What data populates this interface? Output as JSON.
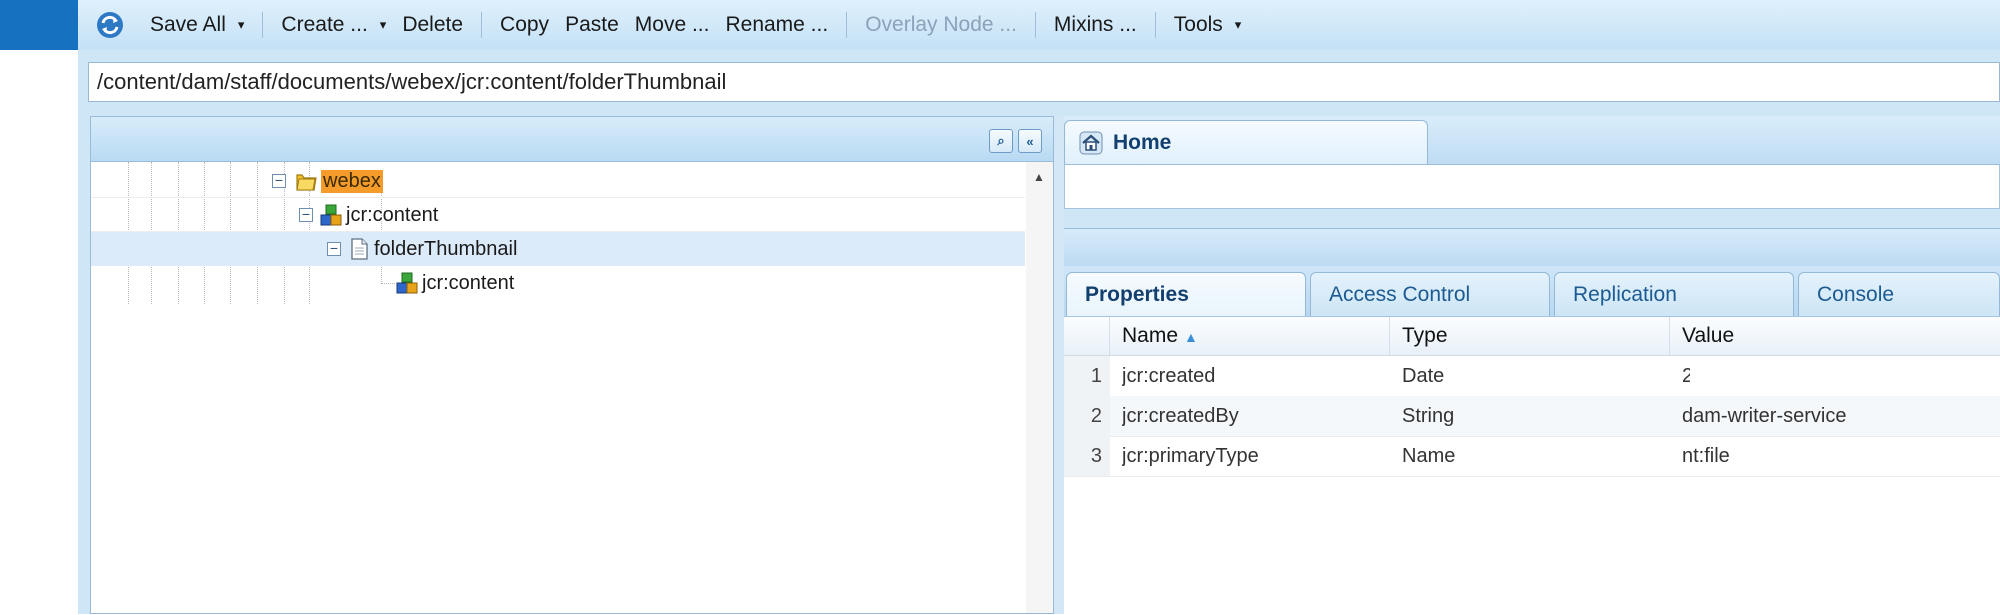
{
  "toolbar": {
    "save_all": "Save All",
    "create": "Create ...",
    "delete": "Delete",
    "copy": "Copy",
    "paste": "Paste",
    "move": "Move ...",
    "rename": "Rename ...",
    "overlay_node": "Overlay Node ...",
    "mixins": "Mixins ...",
    "tools": "Tools",
    "dropdown_glyph": "▾"
  },
  "path": "/content/dam/staff/documents/webex/jcr:content/folderThumbnail",
  "tree": {
    "nodes": [
      {
        "label": "webex",
        "icon": "folder-icon",
        "expanded": true,
        "highlighted": true
      },
      {
        "label": "jcr:content",
        "icon": "node-cubes-icon",
        "expanded": true
      },
      {
        "label": "folderThumbnail",
        "icon": "file-icon",
        "expanded": true,
        "selected": true
      },
      {
        "label": "jcr:content",
        "icon": "node-cubes-icon"
      }
    ],
    "toggle_glyph": "−",
    "scroll_up_glyph": "▲"
  },
  "header_buttons": {
    "find_glyph": "⌕",
    "collapse_glyph": "«"
  },
  "right": {
    "home_tab": "Home",
    "tabs": [
      "Properties",
      "Access Control",
      "Replication",
      "Console"
    ],
    "active_tab": "Properties",
    "columns": [
      "Name",
      "Type",
      "Value"
    ],
    "sort_glyph": "▲",
    "rows": [
      {
        "num": "1",
        "name": "jcr:created",
        "type": "Date",
        "value": "2"
      },
      {
        "num": "2",
        "name": "jcr:createdBy",
        "type": "String",
        "value": "dam-writer-service"
      },
      {
        "num": "3",
        "name": "jcr:primaryType",
        "type": "Name",
        "value": "nt:file"
      }
    ]
  },
  "colors": {
    "accent_blue": "#1671c0",
    "highlight_orange": "#f59b2a",
    "selected_row": "#dcebf9"
  }
}
